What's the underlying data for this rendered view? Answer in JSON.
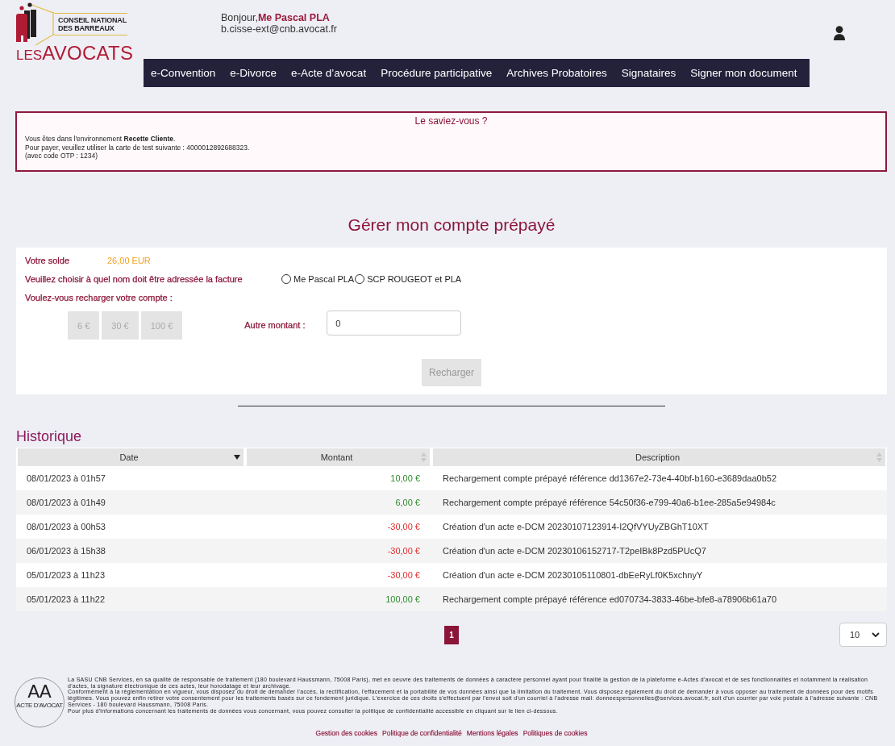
{
  "header": {
    "logo": {
      "line_1": "CONSEIL NATIONAL",
      "line_2": "DES BARREAUX",
      "prefix": "LES",
      "name": "AVOCATS"
    },
    "greeting": {
      "salutation": "Bonjour,",
      "name": "Me Pascal PLA",
      "email": "b.cisse-ext@cnb.avocat.fr"
    },
    "nav": [
      {
        "label": "e-Convention",
        "selected": false
      },
      {
        "label": "e-Divorce",
        "selected": false
      },
      {
        "label": "e-Acte d’avocat",
        "selected": false
      },
      {
        "label": "Procédure participative",
        "selected": false
      },
      {
        "label": "Archives Probatoires",
        "selected": false
      },
      {
        "label": "Signataires",
        "selected": false
      },
      {
        "label": "Signer mon document",
        "selected": false
      }
    ]
  },
  "notice": {
    "title": "Le saviez-vous ?",
    "lines": [
      "Vous êtes dans l'environnement **Recette Cliente**.",
      "Pour payer, veuillez utiliser la carte de test suivante : 4000012892688323.",
      "(avec code OTP : 1234)"
    ]
  },
  "page_title": "Gérer mon compte prépayé",
  "account": {
    "balance_label": "Votre solde",
    "balance": "26,00 EUR",
    "invoice_label": "Veuillez choisir à quel nom doit être adressée la facture",
    "invoice_options": [
      {
        "label": "Me Pascal PLA",
        "selected": false
      },
      {
        "label": "SCP ROUGEOT et PLA",
        "selected": false
      }
    ],
    "recharge_label": "Voulez-vous recharger votre compte :",
    "amounts": [
      {
        "label": "6 €",
        "disabled": true
      },
      {
        "label": "30 €",
        "disabled": true
      },
      {
        "label": "100 €",
        "disabled": true
      }
    ],
    "other_label": "Autre montant :",
    "other_value": "0",
    "submit": {
      "label": "Recharger",
      "disabled": true
    }
  },
  "history": {
    "title": "Historique",
    "columns": [
      {
        "label": "Date",
        "sorted": true
      },
      {
        "label": "Montant",
        "sorted": false
      },
      {
        "label": "Description",
        "sorted": false
      }
    ],
    "rows": [
      {
        "date": "08/01/2023 à 01h57",
        "amount": "10,00 €",
        "color": "#2e8b2e",
        "description": "Rechargement compte prépayé référence dd1367e2-73e4-40bf-b160-e3689daa0b52"
      },
      {
        "date": "08/01/2023 à 01h49",
        "amount": "6,00 €",
        "color": "#2e8b2e",
        "description": "Rechargement compte prépayé référence 54c50f36-e799-40a6-b1ee-285a5e94984c"
      },
      {
        "date": "08/01/2023 à 00h53",
        "amount": "-30,00 €",
        "color": "#e52b2b",
        "description": "Création d'un acte e-DCM 20230107123914-I2QfVYUyZBGhT10XT"
      },
      {
        "date": "06/01/2023 à 15h38",
        "amount": "-30,00 €",
        "color": "#e52b2b",
        "description": "Création d'un acte e-DCM 20230106152717-T2peIBk8Pzd5PUcQ7"
      },
      {
        "date": "05/01/2023 à 11h23",
        "amount": "-30,00 €",
        "color": "#e52b2b",
        "description": "Création d'un acte e-DCM 20230105110801-dbEeRyLf0K5xchnyY"
      },
      {
        "date": "05/01/2023 à 11h22",
        "amount": "100,00 €",
        "color": "#2e8b2e",
        "description": "Rechargement compte prépayé référence ed070734-3833-46be-bfe8-a78906b61a70"
      }
    ],
    "pages": [
      {
        "label": "1",
        "selected": true
      }
    ],
    "page_size": "10"
  },
  "footer": {
    "logo": {
      "monogram": "AA",
      "caption": "ACTE D'AVOCAT"
    },
    "paragraphs": [
      "La SASU CNB Services, en sa qualité de responsable de traitement (180 boulevard Haussmann, 75008 Paris), met en oeuvre des traitements de données à caractère personnel ayant pour finalité la gestion de la plateforme e-Actes d'avocat et de ses fonctionnalités et notamment la réalisation d'actes, la signature électronique de ces actes, leur horodatage et leur archivage.",
      "Conformément à la réglementation en vigueur, vous disposez du droit de demander l'accès, la rectification, l'effacement et la portabilité de vos données ainsi que la limitation du traitement. Vous disposez également du droit de demander à vous opposer au traitement de données pour des motifs légitimes. Vous pouvez enfin retirer votre consentement pour les traitements basés sur ce fondement juridique. L'exercice de ces droits s'effectuent par l'envoi soit d'un courriel à l'adresse mail: donneespersonnelles@services.avocat.fr, soit d'un courrier par voie postale à l'adresse suivante : CNB Services - 180 boulevard Haussmann, 75008 Paris.",
      "Pour plus d'informations concernant les traitements de données vous concernant, vous pouvez consulter la politique de confidentialité accessible en cliquant sur le lien ci-dessous."
    ],
    "links": [
      "Gestion des cookies",
      "Politique de confidentialité",
      "Mentions légales",
      "Politiques de cookies"
    ]
  }
}
